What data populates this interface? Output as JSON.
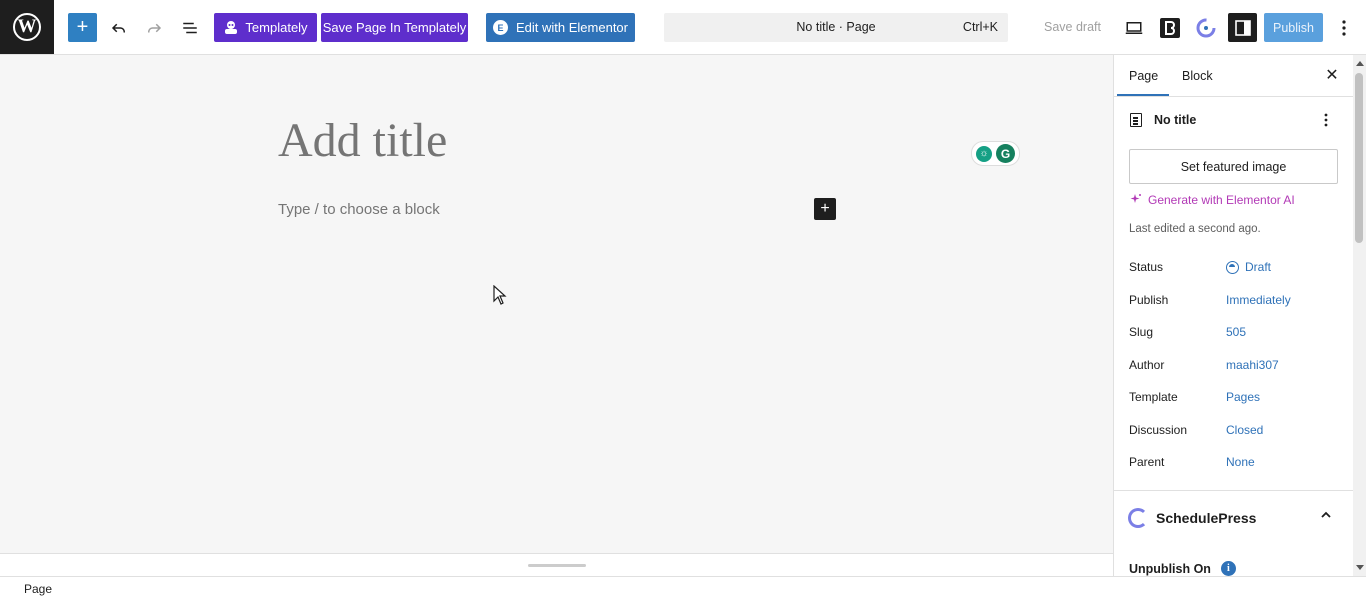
{
  "toolbar": {
    "wp_logo": "W",
    "add_symbol": "+",
    "templately_label": "Templately",
    "save_templately_label": "Save Page In Templately",
    "elementor_label": "Edit with Elementor",
    "command_title": "No title · Page",
    "command_shortcut": "Ctrl+K",
    "save_draft_label": "Save draft",
    "publish_label": "Publish",
    "icons": [
      "wordpress-logo",
      "plus-icon",
      "undo-icon",
      "redo-icon",
      "document-overview-icon",
      "templately-icon",
      "elementor-icon",
      "preview-icon",
      "bricks-icon",
      "schedulepress-icon",
      "settings-sidebar-icon",
      "options-icon"
    ]
  },
  "editor": {
    "title_placeholder": "Add title",
    "block_placeholder": "Type / to choose a block",
    "inserter_symbol": "+"
  },
  "footer": {
    "breadcrumb": "Page"
  },
  "sidebar": {
    "tabs": [
      "Page",
      "Block"
    ],
    "active_tab": "Page",
    "close_symbol": "✕",
    "doc_title": "No title",
    "featured_image_label": "Set featured image",
    "generate_ai_label": "Generate with Elementor AI",
    "last_edited": "Last edited a second ago.",
    "meta": [
      {
        "label": "Status",
        "value": "Draft"
      },
      {
        "label": "Publish",
        "value": "Immediately"
      },
      {
        "label": "Slug",
        "value": "505"
      },
      {
        "label": "Author",
        "value": "maahi307"
      },
      {
        "label": "Template",
        "value": "Pages"
      },
      {
        "label": "Discussion",
        "value": "Closed"
      },
      {
        "label": "Parent",
        "value": "None"
      }
    ],
    "schedulepress": {
      "title": "SchedulePress",
      "unpublish_label": "Unpublish On",
      "info_symbol": "i"
    }
  },
  "colors": {
    "accent_blue": "#2f72b8",
    "templately_purple": "#5e2ecc",
    "ai_magenta": "#b239b6",
    "publish_disabled": "#5aa0dd"
  }
}
